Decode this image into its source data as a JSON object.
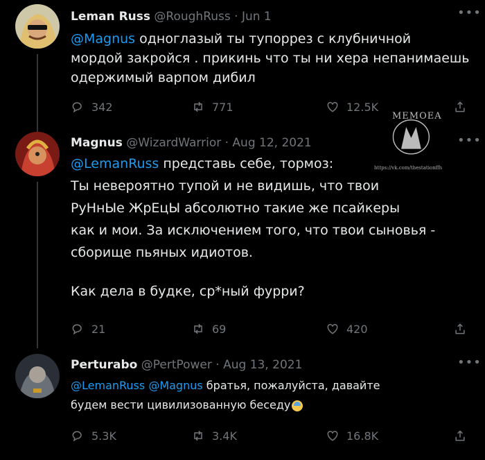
{
  "tweets": [
    {
      "name": "Leman Russ",
      "handle": "@RoughRuss",
      "date": "· Jun 1",
      "mention": "@Magnus",
      "text_line1": " одноглазый ты тупоррез с клубничной",
      "text_line2": "мордой закройся . прикинь что ты ни хера непанимаешь",
      "text_line3": "одержимый варпом дибил",
      "replies": "342",
      "retweets": "771",
      "likes": "12.5K",
      "more": "•••"
    },
    {
      "name": "Magnus",
      "handle": "@WizardWarrior",
      "date": "· Aug 12, 2021",
      "mention": "@LemanRuss",
      "text_line1": " представь себе, тормоз:",
      "text_line2": "Ты невероятно тупой и не видишь, что твои",
      "text_line3": "РуНнЫе ЖрЕцЫ абсолютно такие же псайкеры",
      "text_line4": "как и мои. За исключением того, что твои сыновья -",
      "text_line5": "сборище пьяных идиотов.",
      "text_line6": "Как дела в будке, ср*ный фурри?",
      "replies": "21",
      "retweets": "69",
      "likes": "420",
      "more": "•••"
    },
    {
      "name": "Perturabo",
      "handle": "@PertPower",
      "date": "· Aug 13, 2021",
      "mention1": "@LemanRuss",
      "mention2": "@Magnus",
      "text_line1": " братья, пожалуйста, давайте",
      "text_line2": "будем вести цивилизованную беседу",
      "replies": "5.3K",
      "retweets": "3.4K",
      "likes": "16.8K",
      "more": "•••"
    }
  ],
  "watermark": {
    "title": "MEMOEA",
    "url": "https://vk.com/thestationffh"
  },
  "icons": [
    "reply-icon",
    "retweet-icon",
    "like-icon",
    "share-icon"
  ]
}
